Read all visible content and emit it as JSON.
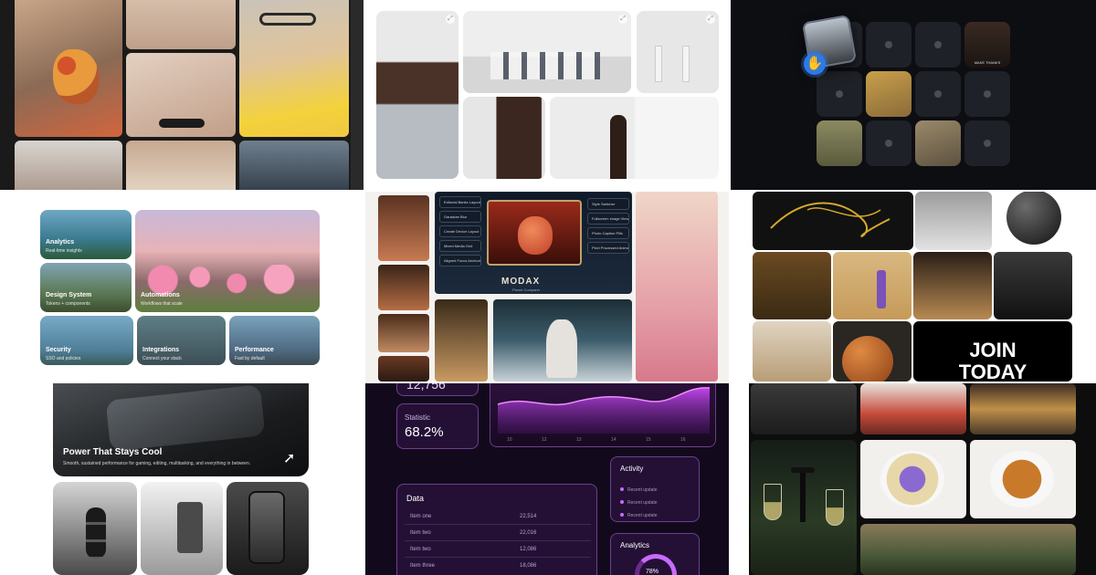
{
  "panel_grid": {
    "panel_1": {
      "name": "fashion-collage"
    },
    "panel_2": {
      "name": "portrait-gallery"
    },
    "panel_3": {
      "name": "drag-drop-grid",
      "caption": "MAKE THANKS"
    },
    "panel_4": {
      "cards": [
        {
          "title": "Analytics",
          "subtitle": "Real-time insights"
        },
        {
          "title": "Design System",
          "subtitle": "Tokens + components"
        },
        {
          "title": "Automations",
          "subtitle": "Workflows that scale"
        },
        {
          "title": "Security",
          "subtitle": "SSO and policies"
        },
        {
          "title": "Integrations",
          "subtitle": "Connect your stack"
        },
        {
          "title": "Performance",
          "subtitle": "Fast by default"
        }
      ]
    },
    "panel_5": {
      "logo": "MODAX",
      "logo_sub": "Planet Comparer",
      "left_controls": [
        "Editorial Banks Layout",
        "Gaussian Blur",
        "Create Device Layout",
        "Mixed Media Grid",
        "Aligned Focus Anchors"
      ],
      "right_controls": [
        "Style Switcher",
        "Fullscreen Image Viewer",
        "Photo Caption Pills",
        "Pixel Processed Animations"
      ]
    },
    "panel_6": {
      "cta_line1": "JOIN",
      "cta_line2": "TODAY"
    },
    "panel_7": {
      "headline": "Power That Stays Cool",
      "description": "Smooth, sustained performance for gaming, editing, multitasking, and everything in between."
    },
    "panel_8": {
      "top_value": "12,756",
      "statistic_label": "Statistic",
      "statistic_value": "68.2%",
      "x_ticks": [
        "10",
        "12",
        "13",
        "14",
        "15",
        "16"
      ],
      "data_title": "Data",
      "rows": [
        {
          "name": "Item one",
          "value": "22,514"
        },
        {
          "name": "Item two",
          "value": "22,016"
        },
        {
          "name": "Item two",
          "value": "12,086"
        },
        {
          "name": "Item three",
          "value": "18,086"
        }
      ],
      "activity_title": "Activity",
      "activity_items": [
        "Recent update",
        "Recent update",
        "Recent update"
      ],
      "analytics_title": "Analytics",
      "analytics_value": "78%",
      "accent": "#c86bff"
    },
    "panel_9": {
      "name": "restaurant-gallery"
    }
  }
}
